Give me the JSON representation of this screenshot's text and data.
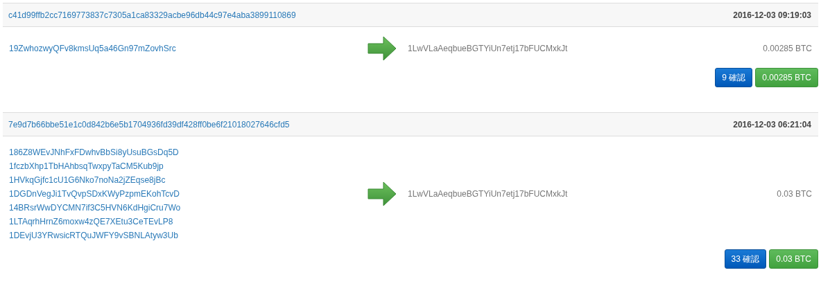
{
  "transactions": [
    {
      "hash": "c41d99ffb2cc7169773837c7305a1ca83329acbe96db44c97e4aba3899110869",
      "time": "2016-12-03 09:19:03",
      "inputs": [
        "19ZwhozwyQFv8kmsUq5a46Gn97mZovhSrc"
      ],
      "outputs": [
        {
          "address": "1LwVLaAeqbueBGTYiUn7etj17bFUCMxkJt",
          "amount": "0.00285 BTC"
        }
      ],
      "confirmations": "9 確認",
      "total": "0.00285 BTC"
    },
    {
      "hash": "7e9d7b66bbe51e1c0d842b6e5b1704936fd39df428ff0be6f21018027646cfd5",
      "time": "2016-12-03 06:21:04",
      "inputs": [
        "186Z8WEvJNhFxFDwhvBbSi8yUsuBGsDq5D",
        "1fczbXhp1TbHAhbsqTwxpyTaCM5Kub9jp",
        "1HVkqGjfc1cU1G6Nko7noNa2jZEqse8jBc",
        "1DGDnVegJi1TvQvpSDxKWyPzpmEKohTcvD",
        "14BRsrWwDYCMN7if3C5HVN6KdHgiCru7Wo",
        "1LTAqrhHrnZ6moxw4zQE7XEtu3CeTEvLP8",
        "1DEvjU3YRwsicRTQuJWFY9vSBNLAtyw3Ub"
      ],
      "outputs": [
        {
          "address": "1LwVLaAeqbueBGTYiUn7etj17bFUCMxkJt",
          "amount": "0.03 BTC"
        }
      ],
      "confirmations": "33 確認",
      "total": "0.03 BTC"
    }
  ]
}
